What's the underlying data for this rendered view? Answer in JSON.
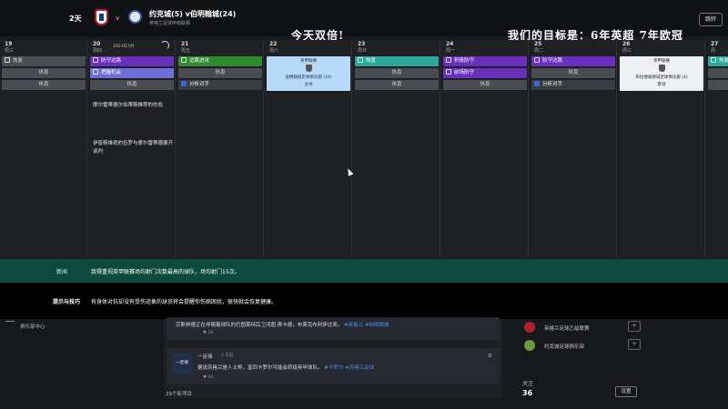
{
  "header": {
    "days": "2天",
    "vs": "v",
    "match_title": "约克城(5) v伯明翰城(24)",
    "match_sub": "英格兰足球甲级联赛",
    "overlay_left": "今天双倍!",
    "overlay_right": "我们的目标是：6年英超 7年欧冠",
    "button": "跳转"
  },
  "calendar": {
    "columns": [
      {
        "day": "19",
        "weekday": "周三"
      },
      {
        "day": "20",
        "weekday": "周四",
        "extra": "2023年3月"
      },
      {
        "day": "21",
        "weekday": "周五"
      },
      {
        "day": "22",
        "weekday": "周六"
      },
      {
        "day": "23",
        "weekday": "周日"
      },
      {
        "day": "24",
        "weekday": "周一"
      },
      {
        "day": "25",
        "weekday": "周二"
      },
      {
        "day": "26",
        "weekday": "周三"
      },
      {
        "day": "27",
        "weekday": "周"
      }
    ],
    "col19": [
      "恢复",
      "休息",
      "休息"
    ],
    "col20": [
      "防守边路",
      "把握机会",
      "休息"
    ],
    "col21": [
      "边路进攻",
      "休息",
      "分析对手"
    ],
    "col22_match": {
      "top": "英甲联赛",
      "name": "伯明翰城足球俱乐部 (24)",
      "bottom": "主场"
    },
    "col23": [
      "恢复",
      "休息",
      "休息"
    ],
    "col24": [
      "积极防守",
      "前场防守",
      "休息"
    ],
    "col25": [
      "防守边路",
      "休息",
      "分析对手"
    ],
    "col26_match": {
      "top": "英甲联赛",
      "name": "布拉德福德城足球俱乐部 (4)",
      "bottom": "客场"
    },
    "col27": [
      "恢复"
    ],
    "notes": [
      "摩尔雷蒂德尔伯蒂斯推荐的伤愈",
      "伊普斯维奇的伍罗与摩尔雷蒂德展开谈判"
    ]
  },
  "news": {
    "label": "新闻",
    "text": "我得重视英甲联赛场均射门次数最高的球队，场均射门15次。"
  },
  "advice": {
    "label": "提示与技巧",
    "text": "有身体对抗却没有受伤迹象的球员将会提醒你伤病困扰，很快就会恢复健康。"
  },
  "sidebar": {
    "item": "俱乐部中心"
  },
  "feed": {
    "post1_text": "宗斯林德正在伴随着球队的巴图莱特后卫鸿图·庚卡德，布莱克布利伊过来。",
    "post1_tags": "#英格兰 #伯明翰城",
    "post1_likes": "16",
    "post2_avatar": "一足球",
    "post2_user": "一足球",
    "post2_time": "4 天前",
    "post2_text": "据说苏格兰是人士称，富同卡罗尔可能会转投英甲球队。",
    "post2_tags": "#卡罗尔 #苏格兰足球",
    "post2_likes": "44",
    "footer": "29个新项目"
  },
  "right_panel": {
    "items": [
      {
        "name": "英格兰足球乙级联赛"
      },
      {
        "name": "约克城足球俱乐部"
      }
    ],
    "follow_label": "关注",
    "follow_count": "36",
    "button": "设置"
  },
  "colors": {
    "purple": "#6b2fbd",
    "lavender": "#6e6fd6",
    "green": "#2f8a2f",
    "teal": "#2ba89a",
    "news_bg": "#0c4a3c",
    "match_card": "#b7d9f7"
  }
}
